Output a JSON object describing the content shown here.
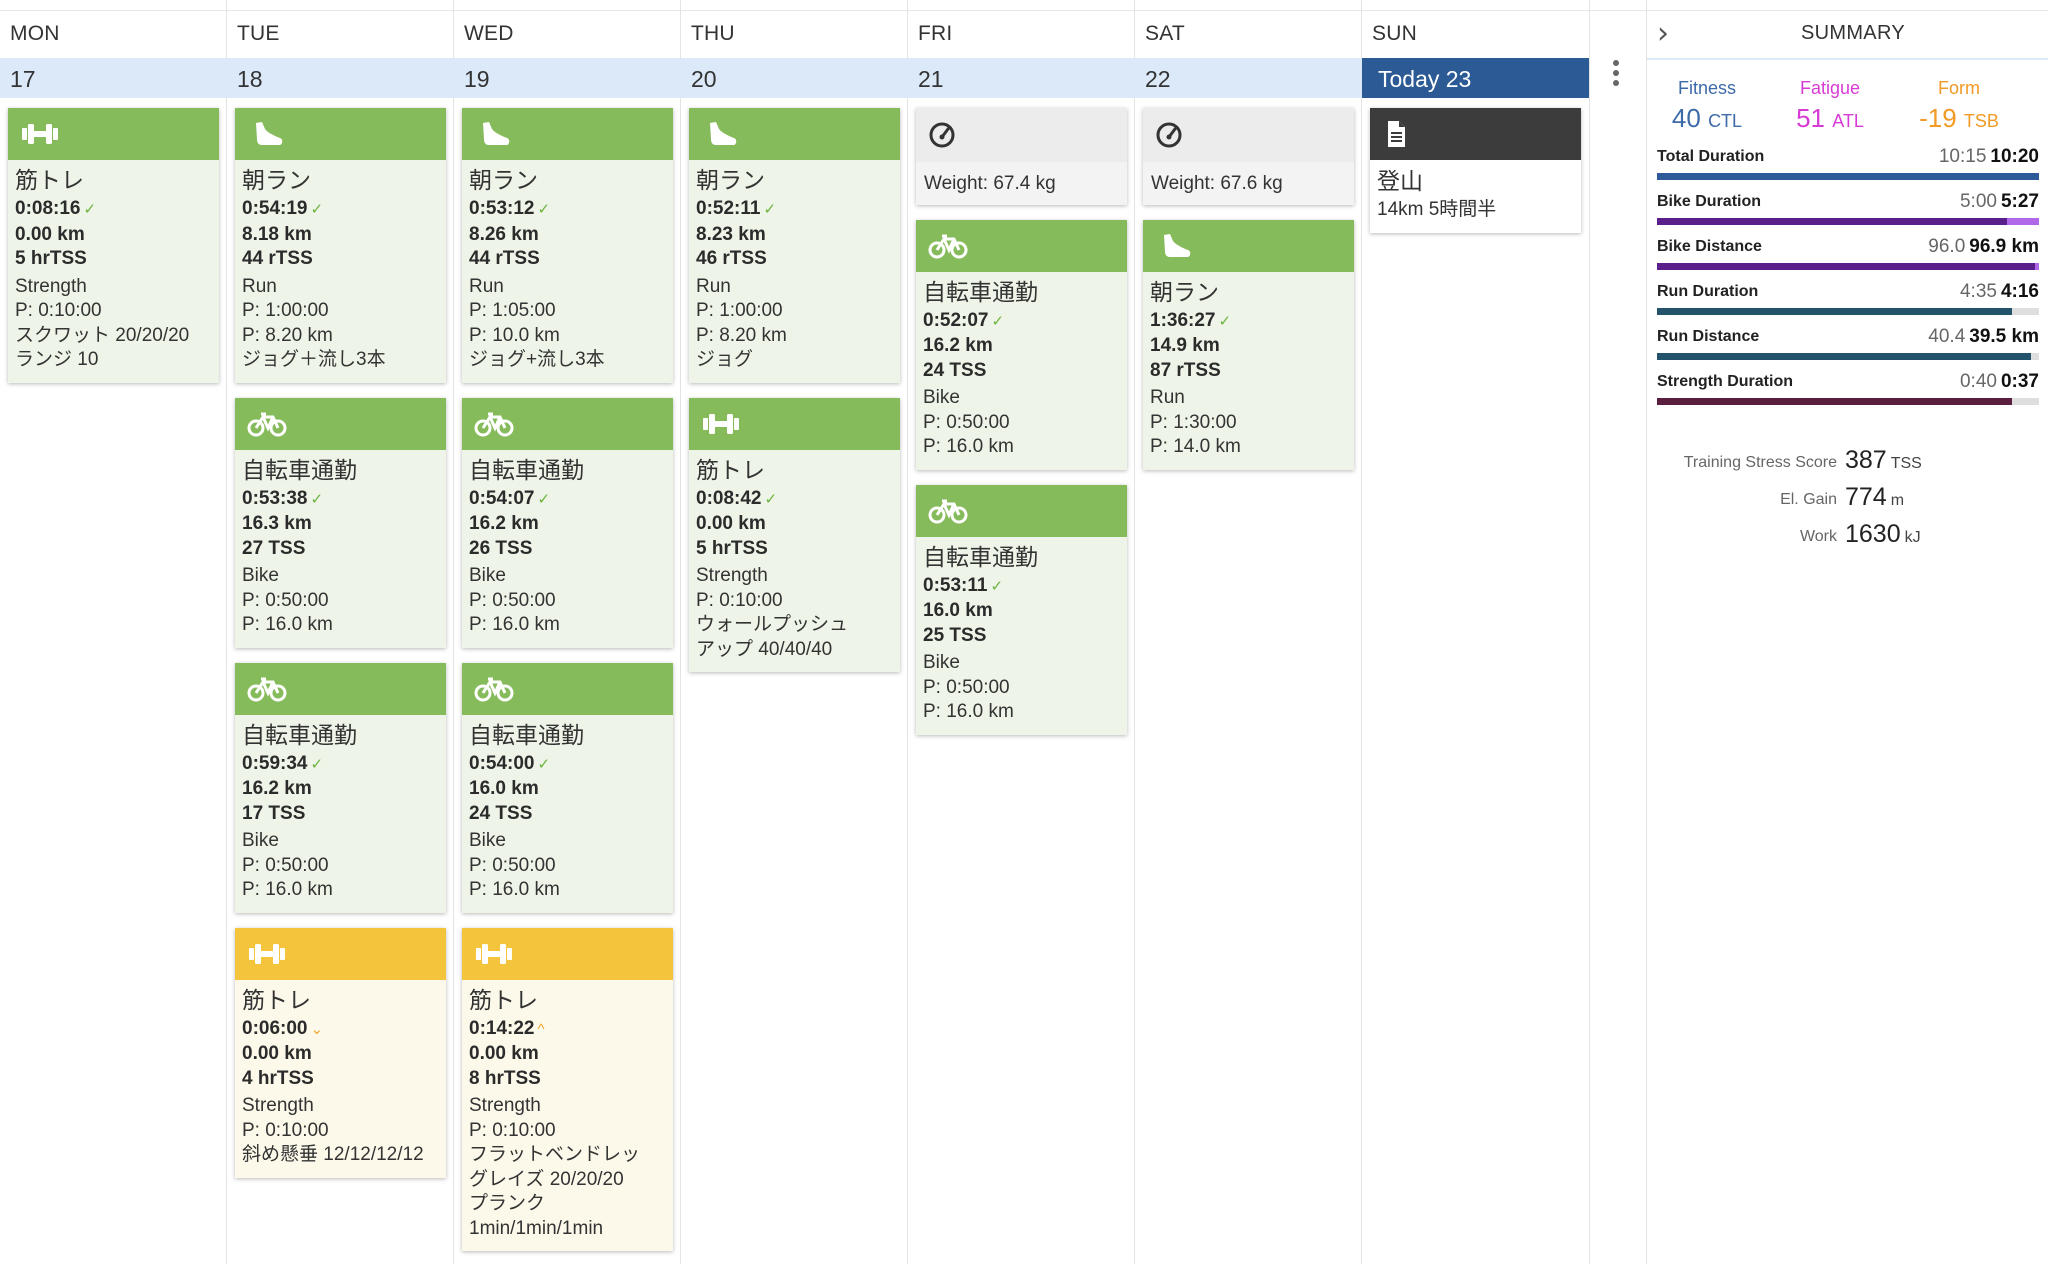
{
  "calendar": {
    "days": [
      {
        "name": "MON",
        "date": "17",
        "cards": [
          {
            "style": "green",
            "icon": "dumbbell",
            "title": "筋トレ",
            "duration": "0:08:16",
            "check": "done",
            "distance": "0.00 km",
            "tss": "5 hrTSS",
            "type": "Strength",
            "planned": [
              "P: 0:10:00"
            ],
            "notes": [
              "スクワット 20/20/20",
              "ランジ 10"
            ]
          }
        ]
      },
      {
        "name": "TUE",
        "date": "18",
        "cards": [
          {
            "style": "green",
            "icon": "shoe",
            "title": "朝ラン",
            "duration": "0:54:19",
            "check": "done",
            "distance": "8.18 km",
            "tss": "44 rTSS",
            "type": "Run",
            "planned": [
              "P: 1:00:00",
              "P: 8.20 km"
            ],
            "notes": [
              "ジョグ＋流し3本"
            ]
          },
          {
            "style": "green",
            "icon": "bike",
            "title": "自転車通勤",
            "duration": "0:53:38",
            "check": "done",
            "distance": "16.3 km",
            "tss": "27 TSS",
            "type": "Bike",
            "planned": [
              "P: 0:50:00",
              "P: 16.0 km"
            ],
            "notes": []
          },
          {
            "style": "green",
            "icon": "bike",
            "title": "自転車通勤",
            "duration": "0:59:34",
            "check": "done",
            "distance": "16.2 km",
            "tss": "17 TSS",
            "type": "Bike",
            "planned": [
              "P: 0:50:00",
              "P: 16.0 km"
            ],
            "notes": []
          },
          {
            "style": "yellow",
            "icon": "dumbbell",
            "title": "筋トレ",
            "duration": "0:06:00",
            "check": "under",
            "distance": "0.00 km",
            "tss": "4 hrTSS",
            "type": "Strength",
            "planned": [
              "P: 0:10:00"
            ],
            "notes": [
              "斜め懸垂 12/12/12/12"
            ]
          }
        ]
      },
      {
        "name": "WED",
        "date": "19",
        "cards": [
          {
            "style": "green",
            "icon": "shoe",
            "title": "朝ラン",
            "duration": "0:53:12",
            "check": "done",
            "distance": "8.26 km",
            "tss": "44 rTSS",
            "type": "Run",
            "planned": [
              "P: 1:05:00",
              "P: 10.0 km"
            ],
            "notes": [
              "ジョグ+流し3本"
            ]
          },
          {
            "style": "green",
            "icon": "bike",
            "title": "自転車通勤",
            "duration": "0:54:07",
            "check": "done",
            "distance": "16.2 km",
            "tss": "26 TSS",
            "type": "Bike",
            "planned": [
              "P: 0:50:00",
              "P: 16.0 km"
            ],
            "notes": []
          },
          {
            "style": "green",
            "icon": "bike",
            "title": "自転車通勤",
            "duration": "0:54:00",
            "check": "done",
            "distance": "16.0 km",
            "tss": "24 TSS",
            "type": "Bike",
            "planned": [
              "P: 0:50:00",
              "P: 16.0 km"
            ],
            "notes": []
          },
          {
            "style": "yellow",
            "icon": "dumbbell",
            "title": "筋トレ",
            "duration": "0:14:22",
            "check": "over",
            "distance": "0.00 km",
            "tss": "8 hrTSS",
            "type": "Strength",
            "planned": [
              "P: 0:10:00"
            ],
            "notes": [
              "フラットベンドレッ",
              "グレイズ 20/20/20",
              "プランク",
              "1min/1min/1min"
            ]
          }
        ]
      },
      {
        "name": "THU",
        "date": "20",
        "cards": [
          {
            "style": "green",
            "icon": "shoe",
            "title": "朝ラン",
            "duration": "0:52:11",
            "check": "done",
            "distance": "8.23 km",
            "tss": "46 rTSS",
            "type": "Run",
            "planned": [
              "P: 1:00:00",
              "P: 8.20 km"
            ],
            "notes": [
              "ジョグ"
            ]
          },
          {
            "style": "green",
            "icon": "dumbbell",
            "title": "筋トレ",
            "duration": "0:08:42",
            "check": "done",
            "distance": "0.00 km",
            "tss": "5 hrTSS",
            "type": "Strength",
            "planned": [
              "P: 0:10:00"
            ],
            "notes": [
              "ウォールプッシュ",
              "アップ 40/40/40"
            ]
          }
        ]
      },
      {
        "name": "FRI",
        "date": "21",
        "cards": [
          {
            "style": "grey",
            "icon": "gauge",
            "weight": "Weight: 67.4 kg"
          },
          {
            "style": "green",
            "icon": "bike",
            "title": "自転車通勤",
            "duration": "0:52:07",
            "check": "done",
            "distance": "16.2 km",
            "tss": "24 TSS",
            "type": "Bike",
            "planned": [
              "P: 0:50:00",
              "P: 16.0 km"
            ],
            "notes": []
          },
          {
            "style": "green",
            "icon": "bike",
            "title": "自転車通勤",
            "duration": "0:53:11",
            "check": "done",
            "distance": "16.0 km",
            "tss": "25 TSS",
            "type": "Bike",
            "planned": [
              "P: 0:50:00",
              "P: 16.0 km"
            ],
            "notes": []
          }
        ]
      },
      {
        "name": "SAT",
        "date": "22",
        "cards": [
          {
            "style": "grey",
            "icon": "gauge",
            "weight": "Weight: 67.6 kg"
          },
          {
            "style": "green",
            "icon": "shoe",
            "title": "朝ラン",
            "duration": "1:36:27",
            "check": "done",
            "distance": "14.9 km",
            "tss": "87 rTSS",
            "type": "Run",
            "planned": [
              "P: 1:30:00",
              "P: 14.0 km"
            ],
            "notes": []
          }
        ]
      },
      {
        "name": "SUN",
        "date": "Today 23",
        "today": true,
        "cards": [
          {
            "style": "note",
            "icon": "document",
            "title": "登山",
            "notes": [
              "14km 5時間半"
            ]
          }
        ]
      }
    ]
  },
  "summary": {
    "title": "SUMMARY",
    "fitness": {
      "label": "Fitness",
      "value": "40",
      "unit": "CTL"
    },
    "fatigue": {
      "label": "Fatigue",
      "value": "51",
      "unit": "ATL"
    },
    "form": {
      "label": "Form",
      "value": "-19",
      "unit": "TSB"
    },
    "bars": [
      {
        "label": "Total Duration",
        "planned": "10:15",
        "actual": "10:20",
        "fraction": 1.0,
        "over": 0,
        "color": "#2e5a99"
      },
      {
        "label": "Bike Duration",
        "planned": "5:00",
        "actual": "5:27",
        "fraction": 0.915,
        "over": 0.085,
        "color": "#5a1f8a"
      },
      {
        "label": "Bike Distance",
        "planned": "96.0",
        "actual": "96.9 km",
        "fraction": 0.99,
        "over": 0.01,
        "color": "#5a1f8a"
      },
      {
        "label": "Run Duration",
        "planned": "4:35",
        "actual": "4:16",
        "fraction": 0.93,
        "over": 0,
        "color": "#23536b"
      },
      {
        "label": "Run Distance",
        "planned": "40.4",
        "actual": "39.5 km",
        "fraction": 0.98,
        "over": 0,
        "color": "#23536b"
      },
      {
        "label": "Strength Duration",
        "planned": "0:40",
        "actual": "0:37",
        "fraction": 0.93,
        "over": 0,
        "color": "#5a1f3f"
      }
    ],
    "totals": [
      {
        "label": "Training Stress Score",
        "value": "387",
        "unit": "TSS"
      },
      {
        "label": "El. Gain",
        "value": "774",
        "unit": "m"
      },
      {
        "label": "Work",
        "value": "1630",
        "unit": "kJ"
      }
    ]
  }
}
